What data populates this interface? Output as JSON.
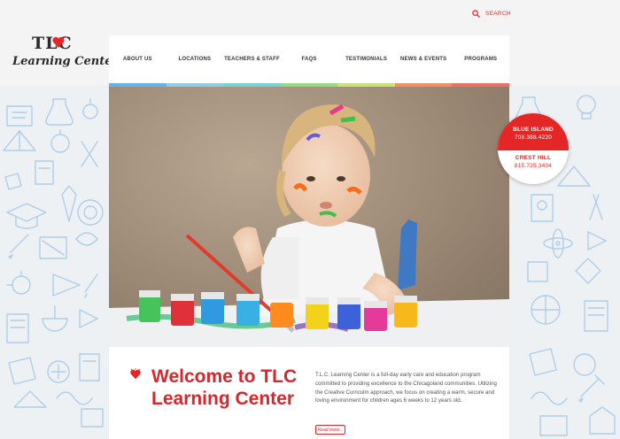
{
  "header": {
    "logo": {
      "line1": "TLC",
      "line2": "Learning Center"
    },
    "search": {
      "label": "SEARCH",
      "icon": "search-icon"
    }
  },
  "nav": {
    "items": [
      {
        "label": "ABOUT US",
        "color": "#64b4ec"
      },
      {
        "label": "LOCATIONS",
        "color": "#92cde6"
      },
      {
        "label": "TEACHERS & STAFF",
        "color": "#77d2d4"
      },
      {
        "label": "FAQS",
        "color": "#93dc86"
      },
      {
        "label": "TESTIMONIALS",
        "color": "#c8e276"
      },
      {
        "label": "NEWS & EVENTS",
        "color": "#f38f62"
      },
      {
        "label": "PROGRAMS",
        "color": "#ee6f66"
      }
    ]
  },
  "phone_badge": {
    "locations": [
      {
        "name": "BLUE ISLAND",
        "phone": "708.388.4220"
      },
      {
        "name": "CREST HILL",
        "phone": "815.725.3404"
      }
    ]
  },
  "welcome": {
    "title": "Welcome to TLC Learning Center",
    "body": "T.L.C. Learning Center is a full-day early care and education program committed to providing excellence to the Chicagoland communities. Utilizing the Creative Curriculm approach, we focus on creating a warm, secure and loving environment for children ages 6 weeks to 12 years old.",
    "read_more": "Read more..."
  },
  "colors": {
    "accent": "#e42726",
    "doodle": "#aecdea"
  }
}
